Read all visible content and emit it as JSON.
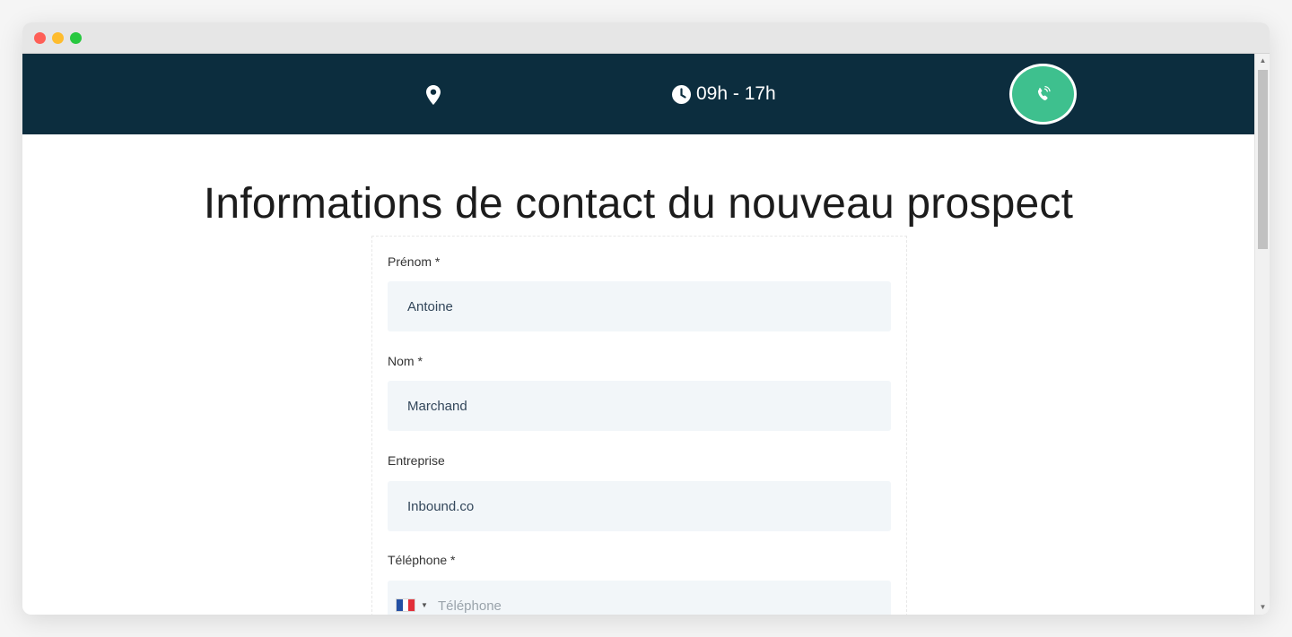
{
  "window": {
    "controls": {
      "close_color": "#fe5f57",
      "minimize_color": "#febc2e",
      "maximize_color": "#28c840"
    }
  },
  "header": {
    "background_color": "#0c2d3e",
    "location_icon": "map-marker-icon",
    "hours_icon": "clock-icon",
    "hours_text": "09h - 17h",
    "call_button_icon": "phone-ringing-icon",
    "call_button_color": "#3ec08e"
  },
  "page": {
    "title": "Informations de contact du nouveau prospect"
  },
  "form": {
    "fields": [
      {
        "label": "Prénom *",
        "value": "Antoine"
      },
      {
        "label": "Nom *",
        "value": "Marchand"
      },
      {
        "label": "Entreprise",
        "value": "Inbound.co"
      }
    ],
    "phone": {
      "label": "Téléphone *",
      "placeholder": "Téléphone",
      "country_icon": "france-flag-icon",
      "value": ""
    }
  }
}
